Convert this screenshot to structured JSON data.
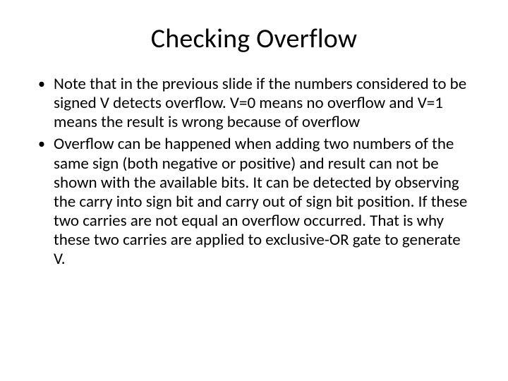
{
  "slide": {
    "title": "Checking Overflow",
    "bullets": [
      "Note that in the previous slide if the numbers considered to be signed  V detects overflow. V=0 means no overflow and V=1 means the result is wrong because of overflow",
      "Overflow can be happened when adding two numbers of the same sign (both negative or positive) and result can not be shown with the available bits. It can be detected by observing the carry into sign bit and carry out of sign bit position.  If these two carries are not equal an overflow occurred. That is why these two carries are applied to exclusive-OR gate to generate V."
    ]
  }
}
